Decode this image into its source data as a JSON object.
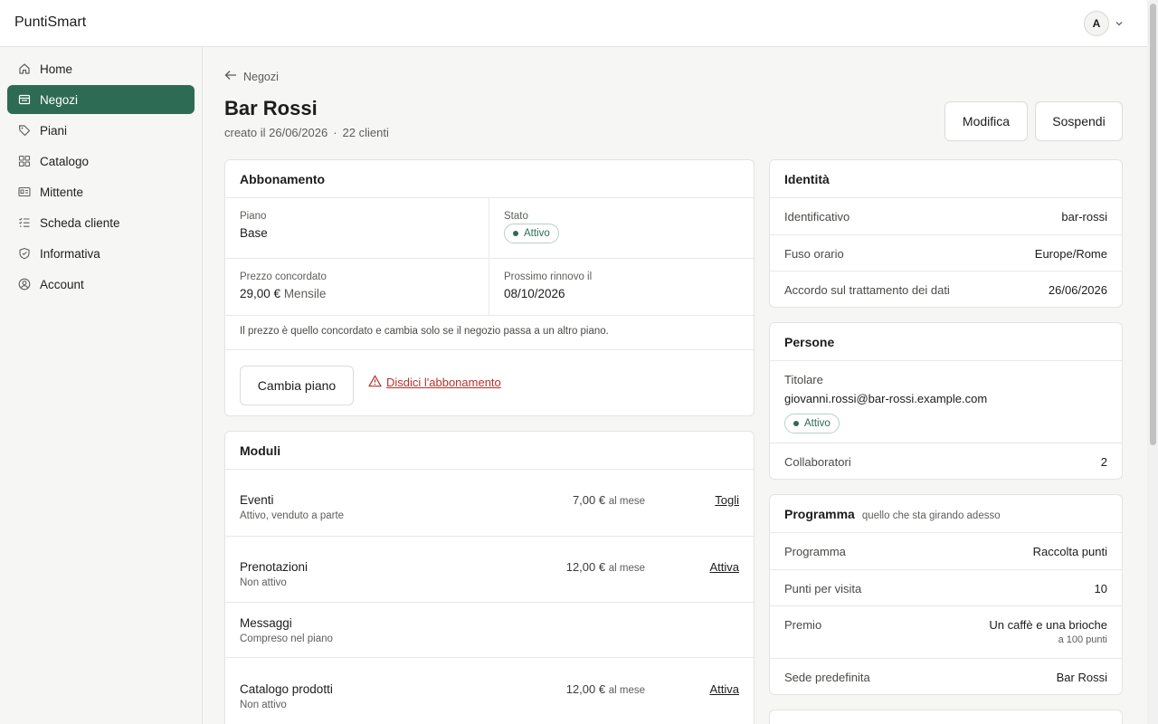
{
  "app": {
    "brand": "PuntiSmart",
    "user_initial": "A"
  },
  "sidebar": {
    "items": [
      {
        "label": "Home",
        "icon": "home-icon"
      },
      {
        "label": "Negozi",
        "icon": "store-icon",
        "active": true
      },
      {
        "label": "Piani",
        "icon": "tag-icon"
      },
      {
        "label": "Catalogo",
        "icon": "grid-icon"
      },
      {
        "label": "Mittente",
        "icon": "id-card-icon"
      },
      {
        "label": "Scheda cliente",
        "icon": "checklist-icon"
      },
      {
        "label": "Informativa",
        "icon": "shield-icon"
      },
      {
        "label": "Account",
        "icon": "user-circle-icon"
      }
    ]
  },
  "header": {
    "back_label": "Negozi",
    "title": "Bar Rossi",
    "created": "creato il 26/06/2026",
    "separator": "·",
    "clients": "22 clienti",
    "edit_label": "Modifica",
    "suspend_label": "Sospendi"
  },
  "subscription": {
    "title": "Abbonamento",
    "plan_label": "Piano",
    "plan_value": "Base",
    "status_label": "Stato",
    "status_value": "Attivo",
    "price_label": "Prezzo concordato",
    "price_value": "29,00 €",
    "price_period": "Mensile",
    "renewal_label": "Prossimo rinnovo il",
    "renewal_value": "08/10/2026",
    "note": "Il prezzo è quello concordato e cambia solo se il negozio passa a un altro piano.",
    "change_plan_label": "Cambia piano",
    "cancel_label": "Disdici l'abbonamento"
  },
  "modules": {
    "title": "Moduli",
    "items": [
      {
        "name": "Eventi",
        "desc": "Attivo, venduto a parte",
        "price": "7,00 €",
        "unit": "al mese",
        "action": "Togli"
      },
      {
        "name": "Prenotazioni",
        "desc": "Non attivo",
        "price": "12,00 €",
        "unit": "al mese",
        "action": "Attiva"
      },
      {
        "name": "Messaggi",
        "desc": "Compreso nel piano",
        "price": "",
        "unit": "",
        "action": ""
      },
      {
        "name": "Catalogo prodotti",
        "desc": "Non attivo",
        "price": "12,00 €",
        "unit": "al mese",
        "action": "Attiva"
      }
    ]
  },
  "identity": {
    "title": "Identità",
    "rows": [
      {
        "k": "Identificativo",
        "v": "bar-rossi"
      },
      {
        "k": "Fuso orario",
        "v": "Europe/Rome"
      },
      {
        "k": "Accordo sul trattamento dei dati",
        "v": "26/06/2026"
      }
    ]
  },
  "people": {
    "title": "Persone",
    "owner_label": "Titolare",
    "owner_email": "giovanni.rossi@bar-rossi.example.com",
    "owner_status": "Attivo",
    "collab_label": "Collaboratori",
    "collab_value": "2"
  },
  "program": {
    "title": "Programma",
    "subtitle": "quello che sta girando adesso",
    "rows": [
      {
        "k": "Programma",
        "v": "Raccolta punti"
      },
      {
        "k": "Punti per visita",
        "v": "10"
      },
      {
        "k": "Premio",
        "v": "Un caffè e una brioche",
        "note": "a 100 punti"
      },
      {
        "k": "Sede predefinita",
        "v": "Bar Rossi"
      }
    ]
  },
  "colors": {
    "accent": "#2e6b55",
    "danger": "#b3332b"
  }
}
